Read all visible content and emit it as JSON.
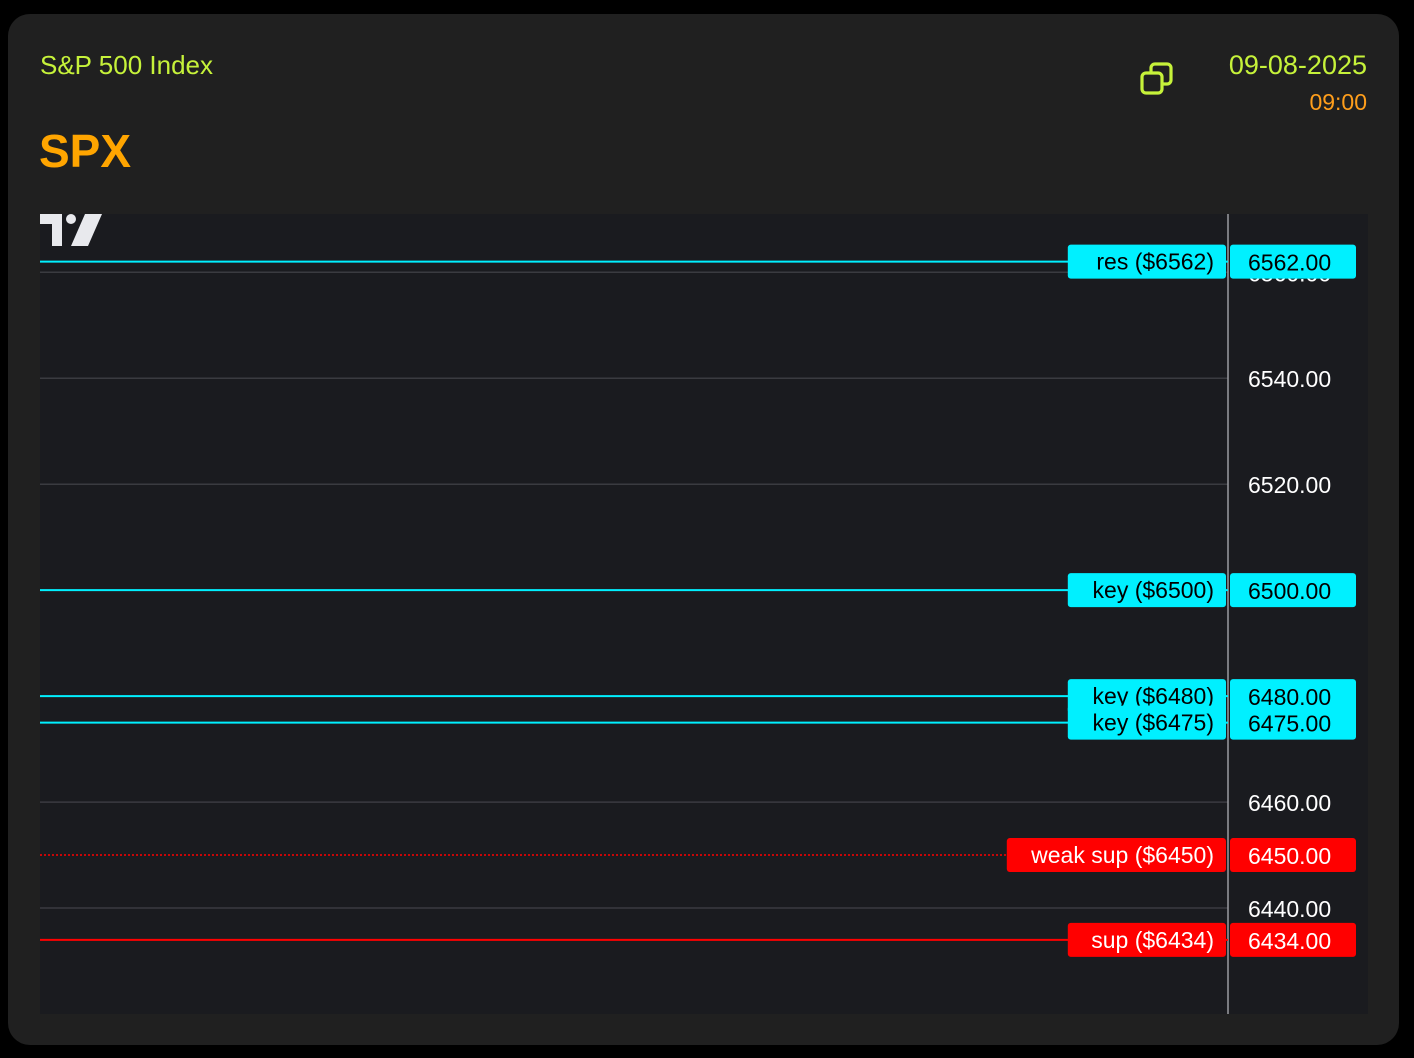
{
  "header": {
    "subtitle": "S&P 500 Index",
    "symbol": "SPX",
    "date": "09-08-2025",
    "time": "09:00",
    "copy_icon": "copy-icon"
  },
  "colors": {
    "subtitle": "#c6f23a",
    "symbol": "#ffa500",
    "time": "#ff9e1b",
    "level_key": "#00f0ff",
    "level_sup": "#ff0000",
    "grid": "#3a3b40",
    "axis_text": "#ffffff",
    "chart_bg": "#1a1b1f"
  },
  "chart_data": {
    "type": "line",
    "title": "",
    "xlabel": "",
    "ylabel": "",
    "ylim": [
      6420,
      6571
    ],
    "y_ticks": [
      "6560.00",
      "6540.00",
      "6520.00",
      "6500.00",
      "6480.00",
      "6460.00",
      "6440.00"
    ],
    "y_tick_values": [
      6560,
      6540,
      6520,
      6500,
      6480,
      6460,
      6440
    ],
    "grid": "horizontal",
    "levels": [
      {
        "label": "res ($6562)",
        "value": 6562,
        "price_label": "6562.00",
        "kind": "res",
        "style": "solid"
      },
      {
        "label": "key ($6500)",
        "value": 6500,
        "price_label": "6500.00",
        "kind": "key",
        "style": "solid"
      },
      {
        "label": "key ($6480)",
        "value": 6480,
        "price_label": "6480.00",
        "kind": "key",
        "style": "solid"
      },
      {
        "label": "key ($6475)",
        "value": 6475,
        "price_label": "6475.00",
        "kind": "key",
        "style": "solid"
      },
      {
        "label": "weak sup ($6450)",
        "value": 6450,
        "price_label": "6450.00",
        "kind": "sup",
        "style": "dotted"
      },
      {
        "label": "sup ($6434)",
        "value": 6434,
        "price_label": "6434.00",
        "kind": "sup",
        "style": "solid"
      }
    ],
    "watermark": "tradingview-logo"
  }
}
